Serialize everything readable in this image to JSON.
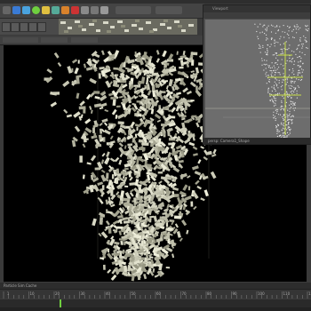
{
  "app": {
    "menubar_label": "",
    "toolbar_icons": [
      "file-icon",
      "undo-icon",
      "redo-icon",
      "select-icon",
      "move-icon",
      "rotate-icon",
      "scale-icon",
      "snap-icon",
      "render-icon",
      "camera-icon",
      "settings-icon"
    ],
    "accent_colors": {
      "green": "#6fcf3f",
      "orange": "#d9822b",
      "red": "#c33",
      "blue": "#3a7bd5",
      "viewport_bg": "#000000"
    }
  },
  "panel": {
    "title": "Viewport",
    "caption": "persp: Camera1_Shape"
  },
  "timeline": {
    "label": "Particle Sim Cache",
    "frame_labels": [
      "1",
      "10",
      "20",
      "30",
      "40",
      "50",
      "60",
      "70",
      "80",
      "90",
      "100",
      "110",
      "120"
    ],
    "current_frame": 22,
    "total_frames": 120
  }
}
